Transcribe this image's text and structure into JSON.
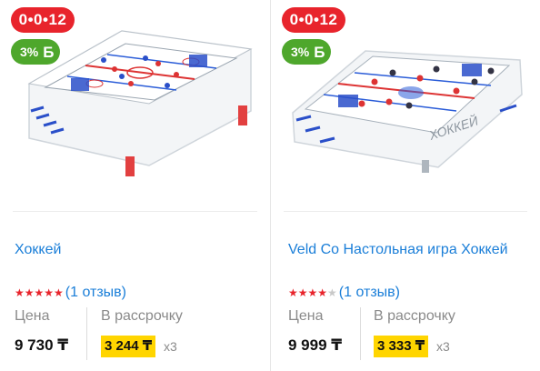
{
  "products": [
    {
      "timer": "0•0•12",
      "bonus": "3%",
      "bonus_icon": "tenge-bonus-icon",
      "title": "Хоккей",
      "rating_stars": 5,
      "reviews": "(1 отзыв)",
      "price_label": "Цена",
      "installment_label": "В рассрочку",
      "price": "9 730 ₸",
      "installment_price": "3 244 ₸",
      "installment_multiplier": "x3"
    },
    {
      "timer": "0•0•12",
      "bonus": "3%",
      "bonus_icon": "tenge-bonus-icon",
      "title": "Veld Co Настольная игра Хоккей",
      "rating_stars": 4,
      "reviews": "(1 отзыв)",
      "price_label": "Цена",
      "installment_label": "В рассрочку",
      "price": "9 999 ₸",
      "installment_price": "3 333 ₸",
      "installment_multiplier": "x3"
    }
  ],
  "colors": {
    "timer_badge": "#e8242c",
    "bonus_badge": "#4ea72c",
    "link": "#1a7ed8",
    "star": "#e8242c",
    "installment_highlight": "#ffd500"
  }
}
